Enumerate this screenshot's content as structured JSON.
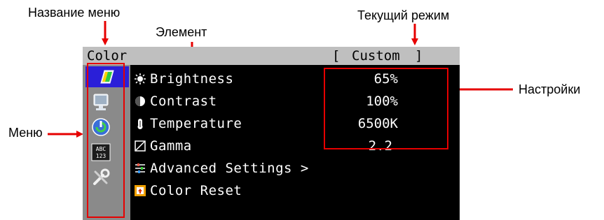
{
  "annotations": {
    "menu_name_label": "Название меню",
    "element_label": "Элемент",
    "current_mode_label": "Текущий режим",
    "settings_label": "Настройки",
    "menu_label": "Меню"
  },
  "osd": {
    "title": "Color",
    "mode": "Custom",
    "menu_icons": [
      "color-icon",
      "screen-icon",
      "power-save-icon",
      "language-icon",
      "tools-icon"
    ],
    "items": [
      {
        "label": "Brightness",
        "value": "65%",
        "icon": "brightness-icon"
      },
      {
        "label": "Contrast",
        "value": "100%",
        "icon": "contrast-icon"
      },
      {
        "label": "Temperature",
        "value": "6500K",
        "icon": "temperature-icon"
      },
      {
        "label": "Gamma",
        "value": "2.2",
        "icon": "gamma-icon"
      },
      {
        "label": "Advanced Settings >",
        "value": "",
        "icon": "advanced-settings-icon"
      },
      {
        "label": "Color Reset",
        "value": "",
        "icon": "color-reset-icon"
      }
    ]
  },
  "colors": {
    "accent_red": "#e60000",
    "selection_blue": "#2a1fd8",
    "titlebar_gray": "#bfbfbf",
    "sidebar_gray": "#8a8a8a"
  }
}
